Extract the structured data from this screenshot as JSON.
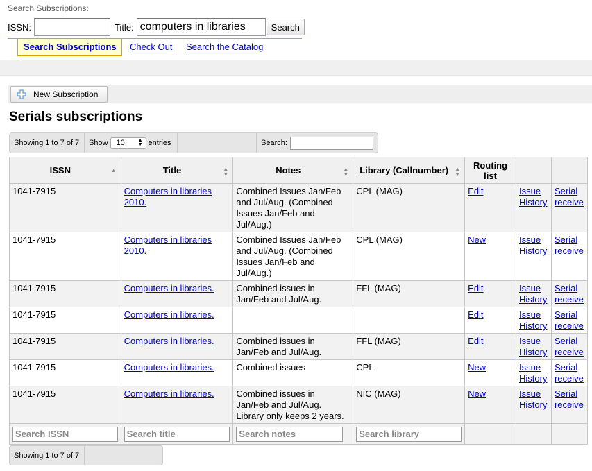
{
  "search": {
    "caption": "Search Subscriptions:",
    "issn_label": "ISSN:",
    "issn_value": "",
    "title_label": "Title:",
    "title_value": "computers in libraries",
    "button": "Search"
  },
  "tabs": [
    {
      "label": "Search Subscriptions",
      "active": true
    },
    {
      "label": "Check Out",
      "active": false
    },
    {
      "label": "Search the Catalog",
      "active": false
    }
  ],
  "toolbar": {
    "new_subscription": "New Subscription"
  },
  "page_title": "Serials subscriptions",
  "datatable": {
    "info": "Showing 1 to 7 of 7",
    "show_label": "Show",
    "length_value": "10",
    "entries_label": "entries",
    "search_label": "Search:",
    "search_value": ""
  },
  "columns": [
    {
      "label": "ISSN",
      "sort": "asc"
    },
    {
      "label": "Title",
      "sort": "both"
    },
    {
      "label": "Notes",
      "sort": "both"
    },
    {
      "label": "Library (Callnumber)",
      "sort": "both"
    },
    {
      "label": "Routing list",
      "sort": "none"
    },
    {
      "label": "",
      "sort": "none"
    },
    {
      "label": "",
      "sort": "none"
    }
  ],
  "rows": [
    {
      "issn": "1041-7915",
      "title": "Computers in libraries 2010.",
      "notes": "Combined Issues Jan/Feb and Jul/Aug. (Combined Issues Jan/Feb and Jul/Aug.)",
      "library": "CPL (MAG)",
      "routing": "Edit",
      "issue_history": "Issue History",
      "serial_receive": "Serial receive"
    },
    {
      "issn": "1041-7915",
      "title": "Computers in libraries 2010.",
      "notes": "Combined Issues Jan/Feb and Jul/Aug. (Combined Issues Jan/Feb and Jul/Aug.)",
      "library": "CPL (MAG)",
      "routing": "New",
      "issue_history": "Issue History",
      "serial_receive": "Serial receive"
    },
    {
      "issn": "1041-7915",
      "title": "Computers in libraries.",
      "notes": "Combined issues in Jan/Feb and Jul/Aug.",
      "library": "FFL (MAG)",
      "routing": "Edit",
      "issue_history": "Issue History",
      "serial_receive": "Serial receive"
    },
    {
      "issn": "1041-7915",
      "title": "Computers in libraries.",
      "notes": "",
      "library": "",
      "routing": "Edit",
      "issue_history": "Issue History",
      "serial_receive": "Serial receive"
    },
    {
      "issn": "1041-7915",
      "title": "Computers in libraries.",
      "notes": "Combined issues in Jan/Feb and Jul/Aug.",
      "library": "FFL (MAG)",
      "routing": "Edit",
      "issue_history": "Issue History",
      "serial_receive": "Serial receive"
    },
    {
      "issn": "1041-7915",
      "title": "Computers in libraries.",
      "notes": "Combined issues",
      "library": "CPL",
      "routing": "New",
      "issue_history": "Issue History",
      "serial_receive": "Serial receive"
    },
    {
      "issn": "1041-7915",
      "title": "Computers in libraries.",
      "notes": "Combined issues in Jan/Feb and Jul/Aug. Library only keeps 2 years.",
      "library": "NIC (MAG)",
      "routing": "New",
      "issue_history": "Issue History",
      "serial_receive": "Serial receive"
    }
  ],
  "filters": {
    "issn": "Search ISSN",
    "title": "Search title",
    "notes": "Search notes",
    "library": "Search library"
  },
  "bottom_info": "Showing 1 to 7 of 7",
  "colors": {
    "link": "#0000cc",
    "tab_border": "#e0a000",
    "tab_bg": "#ffffcc",
    "plus_icon": "#5b9bd5"
  }
}
